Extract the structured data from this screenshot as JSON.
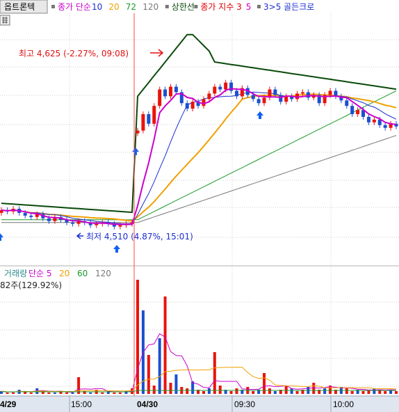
{
  "header": {
    "stock_name": "옵트론텍",
    "items": [
      {
        "label": "종가 단순",
        "color": "#cc00cc"
      },
      {
        "label": "10",
        "color": "#1c2fd1"
      },
      {
        "label": "20",
        "color": "#f0a000"
      },
      {
        "label": "72",
        "color": "#1a9a2a"
      },
      {
        "label": "120",
        "color": "#777777"
      },
      {
        "label": "상한선",
        "color": "#0a4a0a"
      },
      {
        "label": "종가 지수 3",
        "color": "#e00000"
      },
      {
        "label": "5",
        "color": "#cc00cc"
      },
      {
        "label": "3>5 골든크로",
        "color": "#1c2fd1"
      }
    ]
  },
  "annotations": {
    "high_label": "최고 4,625 (-2.27%, 09:08)",
    "low_label": "최저 4,510 (4.87%, 15:01)"
  },
  "volume_panel": {
    "title_items": [
      {
        "label": "거래량",
        "color": "#2a8a8a"
      },
      {
        "label": "단순 5",
        "color": "#cc00cc"
      },
      {
        "label": "20",
        "color": "#f0a000"
      },
      {
        "label": "60",
        "color": "#1a9a2a"
      },
      {
        "label": "120",
        "color": "#777777"
      }
    ],
    "volume_readout": "82주(129.92%)"
  },
  "xaxis": {
    "labels": [
      "4/29",
      "15:00",
      "04/30",
      "09:30",
      "10:00"
    ]
  },
  "colors": {
    "up": "#e8140c",
    "down": "#1c4fd0",
    "ma5": "#cc00cc",
    "ma10": "#1c2fd1",
    "ma20": "#f0a000",
    "ma72": "#1a9a2a",
    "ma120": "#777777",
    "upper_band": "#0a4a0a",
    "ema3": "#e00000",
    "session_line": "#ff4444",
    "grid": "#cfcfcf",
    "axis_bg": "#dfe6ef",
    "arrow": "#1060f0"
  },
  "chart_data": {
    "type": "candlestick",
    "price_range": {
      "min": 4490,
      "max": 4660
    },
    "high": {
      "price": 4625,
      "change": "-2.27%",
      "time": "09:08"
    },
    "low": {
      "price": 4510,
      "change": "4.87%",
      "time": "15:01"
    },
    "close_series_prev_session": [
      4522,
      4521,
      4523,
      4520,
      4518,
      4517,
      4519,
      4516,
      4514,
      4517,
      4515,
      4513,
      4512,
      4514,
      4513,
      4511,
      4512,
      4513,
      4512,
      4510,
      4511,
      4512,
      4513
    ],
    "close_series_current_session": [
      4580,
      4592,
      4585,
      4598,
      4610,
      4605,
      4612,
      4608,
      4600,
      4596,
      4601,
      4598,
      4603,
      4607,
      4612,
      4610,
      4615,
      4609,
      4605,
      4611,
      4606,
      4603,
      4600,
      4604,
      4610,
      4606,
      4601,
      4605,
      4603,
      4607,
      4608,
      4604,
      4606,
      4600,
      4606,
      4609,
      4605,
      4602,
      4598,
      4592,
      4595,
      4590,
      4586,
      4588,
      4584,
      4582,
      4585,
      4583
    ],
    "volume_peak": 82
  }
}
